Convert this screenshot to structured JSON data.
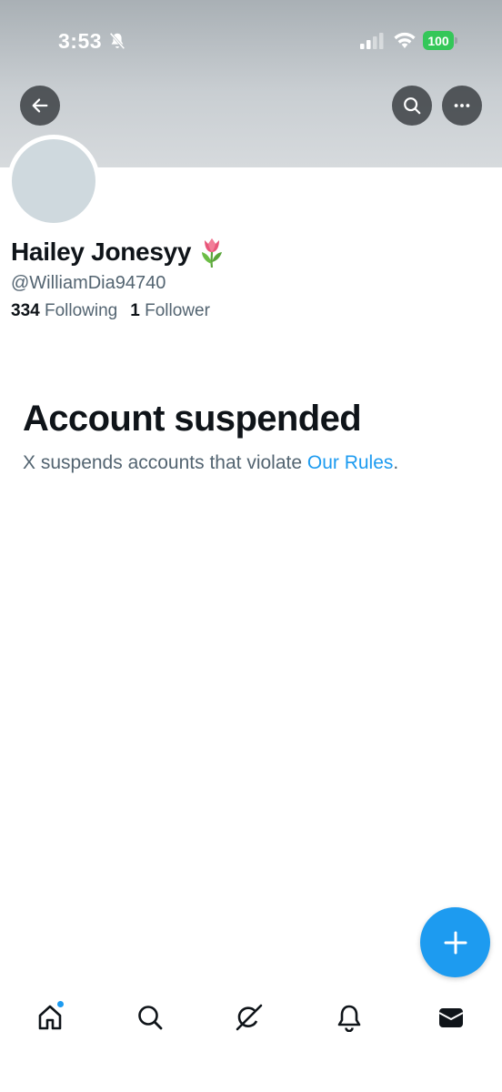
{
  "status_bar": {
    "time": "3:53",
    "battery": "100",
    "battery_color": "#34c759"
  },
  "header": {
    "back_icon": "arrow-left-icon",
    "search_icon": "search-icon",
    "more_icon": "more-horizontal-icon"
  },
  "profile": {
    "display_name": "Hailey Jonesyy",
    "name_emoji": "tulip-icon",
    "handle": "@WilliamDia94740",
    "following_count": "334",
    "following_label": "Following",
    "followers_count": "1",
    "followers_label": "Follower"
  },
  "suspension": {
    "title": "Account suspended",
    "text": "X suspends accounts that violate ",
    "link": "Our Rules",
    "suffix": "."
  },
  "fab": {
    "icon": "plus-icon",
    "color": "#1d9bf0"
  },
  "tab_bar": {
    "items": [
      {
        "name": "home",
        "icon": "home-icon",
        "has_badge": true
      },
      {
        "name": "search",
        "icon": "search-icon"
      },
      {
        "name": "grok",
        "icon": "grok-icon"
      },
      {
        "name": "notifications",
        "icon": "bell-icon"
      },
      {
        "name": "messages",
        "icon": "mail-icon"
      }
    ]
  },
  "colors": {
    "accent": "#1d9bf0",
    "text_primary": "#0f1419",
    "text_secondary": "#536471"
  }
}
